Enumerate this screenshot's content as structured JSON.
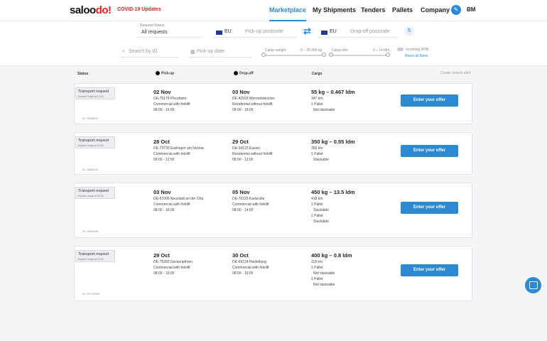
{
  "header": {
    "logo_main": "saloo",
    "logo_accent": "do!",
    "covid": "COVID-19 Updates",
    "nav": [
      {
        "label": "Marketplace",
        "active": true
      },
      {
        "label": "My Shipments",
        "active": false
      },
      {
        "label": "Tenders",
        "active": false
      },
      {
        "label": "Pallets",
        "active": false
      },
      {
        "label": "Company",
        "active": false
      }
    ],
    "user_initials": "BM",
    "compass_icon": "compass-icon"
  },
  "filters": {
    "request_status_label": "Request Status",
    "request_status_value": "All requests",
    "pickup_region": "EU",
    "pickup_placeholder": "Pick-up postcode",
    "dropoff_region": "EU",
    "dropoff_placeholder": "Drop-off postcode",
    "search_placeholder": "Search by ID",
    "pickup_date_placeholder": "Pick-up date",
    "cargo_weight_label": "Cargo weight",
    "cargo_weight_range": "0 – 25.000 kg",
    "cargo_ldm_label": "Cargo ldm",
    "cargo_ldm_range": "0 – 14 ldm",
    "toggle_label": "Incoming RHB",
    "reset_label": "Reset all filters"
  },
  "columns": {
    "status": "Status",
    "pickup": "Pick-up",
    "dropoff": "Drop-off",
    "cargo": "Cargo",
    "save_search": "Create search alert"
  },
  "cards": [
    {
      "status": "Transport request",
      "expires": "Expires Today at 12:00",
      "id": "ID: 3590525",
      "pickup_date": "02 Nov",
      "pickup_place": "DE-75179 Pforzheim",
      "pickup_type": "Commercial with forklift",
      "pickup_time": "08:00 - 16:00",
      "dropoff_date": "03 Nov",
      "dropoff_place": "DE-42929 Wermelskirchen",
      "dropoff_type": "Residential without forklift",
      "dropoff_time": "08:00 - 18:00",
      "cargo_title": "55 kg – 0.467 ldm",
      "cargo_lines": [
        "347 km",
        "1 Pallet",
        "Not stackable"
      ],
      "offer_label": "Enter your offer"
    },
    {
      "status": "Transport request",
      "expires": "Expires Today at 12:00",
      "id": "ID: 3885145",
      "pickup_date": "28 Oct",
      "pickup_place": "DE-73730 Esslingen am Neckar",
      "pickup_type": "Commercial with forklift",
      "pickup_time": "09:00 - 12:00",
      "dropoff_date": "29 Oct",
      "dropoff_place": "DE-34123 Kassel",
      "dropoff_type": "Residential without forklift",
      "dropoff_time": "08:00 - 12:00",
      "cargo_title": "350 kg – 0.55 ldm",
      "cargo_lines": [
        "369 km",
        "1 Pallet",
        "Stackable"
      ],
      "offer_label": "Enter your offer"
    },
    {
      "status": "Transport request",
      "expires": "Expires Today at 12:00",
      "id": "ID: 3590098",
      "pickup_date": "03 Nov",
      "pickup_place": "DE-67006 Neustadt an der Orla",
      "pickup_type": "Commercial with forklift",
      "pickup_time": "08:00 - 16:00",
      "dropoff_date": "05 Nov",
      "dropoff_place": "DE-76229 Karlsruhe",
      "dropoff_type": "Commercial with forklift",
      "dropoff_time": "08:00 - 14:00",
      "cargo_title": "450 kg – 13.5 ldm",
      "cargo_lines": [
        "418 km",
        "1 Pallet",
        "Stackable",
        "1 Pallet",
        "Stackable"
      ],
      "offer_label": "Enter your offer"
    },
    {
      "status": "Transport request",
      "expires": "Expires Today at 12:00",
      "id": "ID: MYY9284",
      "pickup_date": "29 Oct",
      "pickup_place": "DE-75392 Deckenpfronn",
      "pickup_type": "Commercial with forklift",
      "pickup_time": "08:00 - 16:00",
      "dropoff_date": "30 Oct",
      "dropoff_place": "DE-69124 Heidelberg",
      "dropoff_type": "Commercial with forklift",
      "dropoff_time": "08:00 - 16:00",
      "cargo_title": "400 kg – 0.8 ldm",
      "cargo_lines": [
        "118 km",
        "1 Pallet",
        "Not stackable",
        "1 Pallet",
        "Not stackable"
      ],
      "offer_label": "Enter your offer"
    }
  ],
  "colors": {
    "accent": "#2b8ad3",
    "brand_red": "#e2231a"
  },
  "chat_icon": "chat-bubble-icon"
}
